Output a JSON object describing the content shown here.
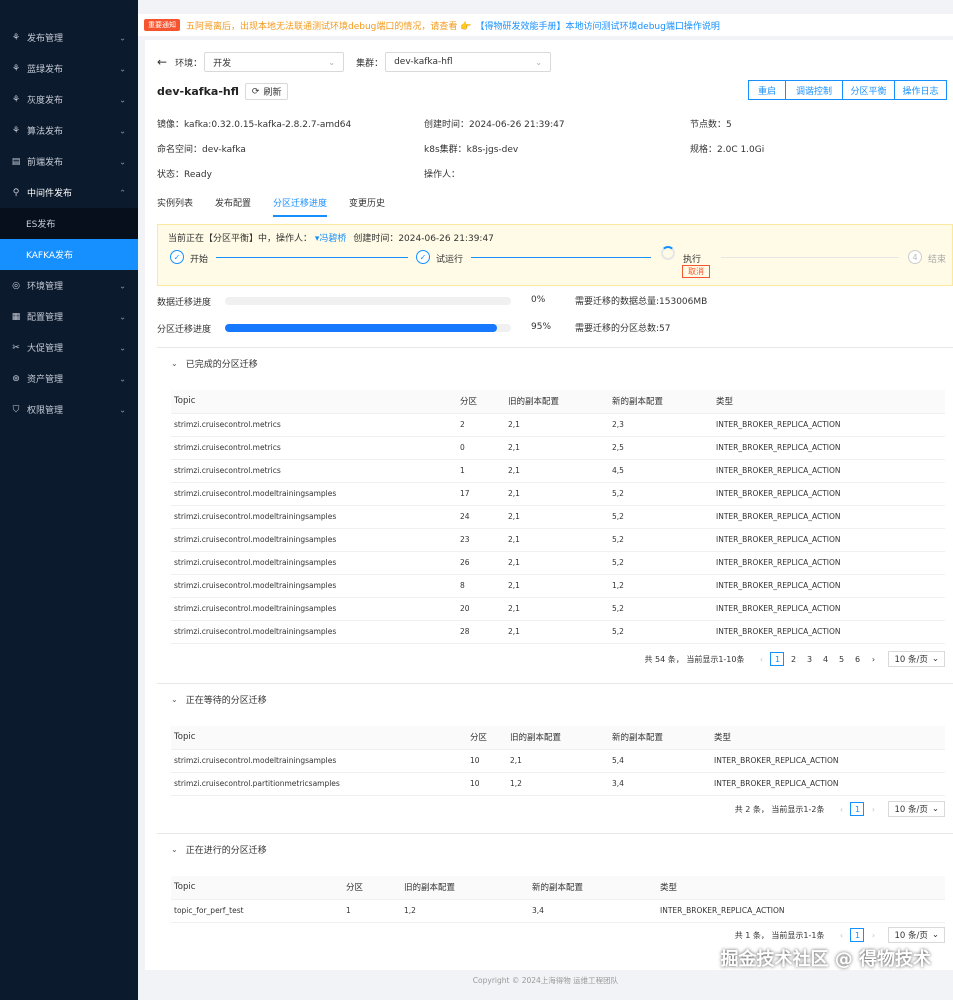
{
  "sidebar": {
    "items": [
      {
        "label": "发布管理",
        "icon": "deploy-icon"
      },
      {
        "label": "蓝绿发布",
        "icon": "deploy-icon"
      },
      {
        "label": "灰度发布",
        "icon": "deploy-icon"
      },
      {
        "label": "算法发布",
        "icon": "deploy-icon"
      },
      {
        "label": "前端发布",
        "icon": "frontend-icon"
      },
      {
        "label": "中间件发布",
        "icon": "middleware-icon",
        "open": true
      },
      {
        "label": "环境管理",
        "icon": "location-icon"
      },
      {
        "label": "配置管理",
        "icon": "config-icon"
      },
      {
        "label": "大促管理",
        "icon": "promo-icon"
      },
      {
        "label": "资产管理",
        "icon": "asset-icon"
      },
      {
        "label": "权限管理",
        "icon": "shield-icon"
      }
    ],
    "sub_items": [
      {
        "label": "ES发布"
      },
      {
        "label": "KAFKA发布",
        "active": true
      }
    ]
  },
  "notice": {
    "tag": "重要通知",
    "text": "五阿哥离后，出现本地无法联通测试环境debug端口的情况，请查看 👉",
    "link": "【得物研发效能手册】本地访问测试环境debug端口操作说明"
  },
  "filters": {
    "env_label": "环境：",
    "env_value": "开发",
    "cluster_label": "集群：",
    "cluster_value": "dev-kafka-hfl"
  },
  "header": {
    "title": "dev-kafka-hfl",
    "refresh": "刷新",
    "actions": [
      "重启",
      "调谐控制",
      "分区平衡",
      "操作日志"
    ]
  },
  "info": {
    "image": "镜像：kafka:0.32.0.15-kafka-2.8.2.7-amd64",
    "created": "创建时间：2024-06-26 21:39:47",
    "nodes": "节点数：5",
    "namespace": "命名空间：dev-kafka",
    "k8s": "k8s集群：k8s-jgs-dev",
    "spec": "规格：2.0C 1.0Gi",
    "status": "状态：Ready",
    "operator": "操作人："
  },
  "tabs": [
    "实例列表",
    "发布配置",
    "分区迁移进度",
    "变更历史"
  ],
  "progress": {
    "status_line": "当前正在【分区平衡】中，操作人：",
    "operator": "冯碧桥",
    "created": "创建时间：2024-06-26 21:39:47",
    "steps": [
      "开始",
      "试运行",
      "执行",
      "结束"
    ],
    "cancel": "取消",
    "data_label": "数据迁移进度",
    "data_pct": 0,
    "data_pct_text": "0%",
    "data_total": "需要迁移的数据总量:153006MB",
    "part_label": "分区迁移进度",
    "part_pct": 95,
    "part_pct_text": "95%",
    "part_total": "需要迁移的分区总数:57"
  },
  "completed": {
    "title": "已完成的分区迁移",
    "headers": [
      "Topic",
      "分区",
      "旧的副本配置",
      "新的副本配置",
      "类型"
    ],
    "rows": [
      [
        "strimzi.cruisecontrol.metrics",
        "2",
        "2,1",
        "2,3",
        "INTER_BROKER_REPLICA_ACTION"
      ],
      [
        "strimzi.cruisecontrol.metrics",
        "0",
        "2,1",
        "2,5",
        "INTER_BROKER_REPLICA_ACTION"
      ],
      [
        "strimzi.cruisecontrol.metrics",
        "1",
        "2,1",
        "4,5",
        "INTER_BROKER_REPLICA_ACTION"
      ],
      [
        "strimzi.cruisecontrol.modeltrainingsamples",
        "17",
        "2,1",
        "5,2",
        "INTER_BROKER_REPLICA_ACTION"
      ],
      [
        "strimzi.cruisecontrol.modeltrainingsamples",
        "24",
        "2,1",
        "5,2",
        "INTER_BROKER_REPLICA_ACTION"
      ],
      [
        "strimzi.cruisecontrol.modeltrainingsamples",
        "23",
        "2,1",
        "5,2",
        "INTER_BROKER_REPLICA_ACTION"
      ],
      [
        "strimzi.cruisecontrol.modeltrainingsamples",
        "26",
        "2,1",
        "5,2",
        "INTER_BROKER_REPLICA_ACTION"
      ],
      [
        "strimzi.cruisecontrol.modeltrainingsamples",
        "8",
        "2,1",
        "1,2",
        "INTER_BROKER_REPLICA_ACTION"
      ],
      [
        "strimzi.cruisecontrol.modeltrainingsamples",
        "20",
        "2,1",
        "5,2",
        "INTER_BROKER_REPLICA_ACTION"
      ],
      [
        "strimzi.cruisecontrol.modeltrainingsamples",
        "28",
        "2,1",
        "5,2",
        "INTER_BROKER_REPLICA_ACTION"
      ]
    ],
    "pager_text": "共 54 条，  当前显示1-10条",
    "pages": [
      "1",
      "2",
      "3",
      "4",
      "5",
      "6"
    ],
    "page_size": "10 条/页"
  },
  "waiting": {
    "title": "正在等待的分区迁移",
    "headers": [
      "Topic",
      "分区",
      "旧的副本配置",
      "新的副本配置",
      "类型"
    ],
    "rows": [
      [
        "strimzi.cruisecontrol.modeltrainingsamples",
        "10",
        "2,1",
        "5,4",
        "INTER_BROKER_REPLICA_ACTION"
      ],
      [
        "strimzi.cruisecontrol.partitionmetricsamples",
        "10",
        "1,2",
        "3,4",
        "INTER_BROKER_REPLICA_ACTION"
      ]
    ],
    "pager_text": "共 2 条，  当前显示1-2条",
    "pages": [
      "1"
    ],
    "page_size": "10 条/页"
  },
  "running": {
    "title": "正在进行的分区迁移",
    "headers": [
      "Topic",
      "分区",
      "旧的副本配置",
      "新的副本配置",
      "类型"
    ],
    "rows": [
      [
        "topic_for_perf_test",
        "1",
        "1,2",
        "3,4",
        "INTER_BROKER_REPLICA_ACTION"
      ]
    ],
    "pager_text": "共 1 条，  当前显示1-1条",
    "pages": [
      "1"
    ],
    "page_size": "10 条/页"
  },
  "footer": "Copyright © 2024上海得物 运维工程团队",
  "watermark": "掘金技术社区 @ 得物技术"
}
